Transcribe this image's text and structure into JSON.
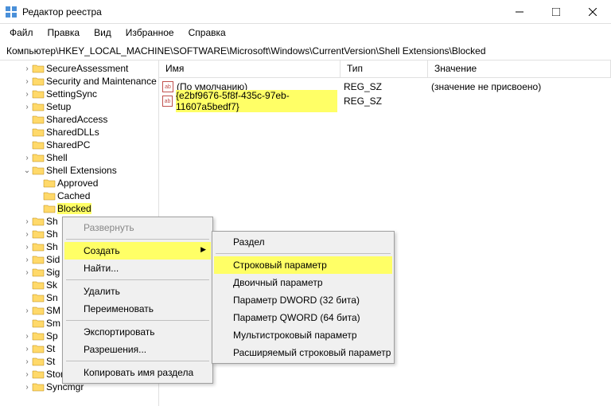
{
  "title": "Редактор реестра",
  "menu": [
    "Файл",
    "Правка",
    "Вид",
    "Избранное",
    "Справка"
  ],
  "address": "Компьютер\\HKEY_LOCAL_MACHINE\\SOFTWARE\\Microsoft\\Windows\\CurrentVersion\\Shell Extensions\\Blocked",
  "tree": [
    {
      "label": "SecureAssessment",
      "exp": ">",
      "ind": 2
    },
    {
      "label": "Security and Maintenance",
      "exp": ">",
      "ind": 2
    },
    {
      "label": "SettingSync",
      "exp": ">",
      "ind": 2
    },
    {
      "label": "Setup",
      "exp": ">",
      "ind": 2
    },
    {
      "label": "SharedAccess",
      "exp": "",
      "ind": 2
    },
    {
      "label": "SharedDLLs",
      "exp": "",
      "ind": 2
    },
    {
      "label": "SharedPC",
      "exp": "",
      "ind": 2
    },
    {
      "label": "Shell",
      "exp": ">",
      "ind": 2
    },
    {
      "label": "Shell Extensions",
      "exp": "v",
      "ind": 2
    },
    {
      "label": "Approved",
      "exp": "",
      "ind": 3
    },
    {
      "label": "Cached",
      "exp": "",
      "ind": 3
    },
    {
      "label": "Blocked",
      "exp": "",
      "ind": 3,
      "sel": true
    },
    {
      "label": "Sh",
      "exp": ">",
      "ind": 2,
      "partial": true
    },
    {
      "label": "Sh",
      "exp": ">",
      "ind": 2,
      "partial": true
    },
    {
      "label": "Sh",
      "exp": ">",
      "ind": 2,
      "partial": true
    },
    {
      "label": "Sid",
      "exp": ">",
      "ind": 2,
      "partial": true
    },
    {
      "label": "Sig",
      "exp": ">",
      "ind": 2,
      "partial": true
    },
    {
      "label": "Sk",
      "exp": "",
      "ind": 2,
      "partial": true
    },
    {
      "label": "Sn",
      "exp": "",
      "ind": 2,
      "partial": true
    },
    {
      "label": "SM",
      "exp": ">",
      "ind": 2,
      "partial": true
    },
    {
      "label": "Sm",
      "exp": "",
      "ind": 2,
      "partial": true
    },
    {
      "label": "Sp",
      "exp": ">",
      "ind": 2,
      "partial": true
    },
    {
      "label": "St",
      "exp": ">",
      "ind": 2,
      "partial": true
    },
    {
      "label": "St",
      "exp": ">",
      "ind": 2,
      "partial": true
    },
    {
      "label": "Store",
      "exp": ">",
      "ind": 2
    },
    {
      "label": "Syncmgr",
      "exp": ">",
      "ind": 2
    }
  ],
  "cols": {
    "name": "Имя",
    "type": "Тип",
    "val": "Значение"
  },
  "rows": [
    {
      "name": "(По умолчанию)",
      "type": "REG_SZ",
      "val": "(значение не присвоено)",
      "hl": false
    },
    {
      "name": "{e2bf9676-5f8f-435c-97eb-11607a5bedf7}",
      "type": "REG_SZ",
      "val": "",
      "hl": true
    }
  ],
  "ctx": {
    "expand": "Развернуть",
    "create": "Создать",
    "find": "Найти...",
    "delete": "Удалить",
    "rename": "Переименовать",
    "export": "Экспортировать",
    "perms": "Разрешения...",
    "copy": "Копировать имя раздела"
  },
  "sub": {
    "key": "Раздел",
    "string": "Строковый параметр",
    "binary": "Двоичный параметр",
    "dword": "Параметр DWORD (32 бита)",
    "qword": "Параметр QWORD (64 бита)",
    "multi": "Мультистроковый параметр",
    "expand": "Расширяемый строковый параметр"
  }
}
